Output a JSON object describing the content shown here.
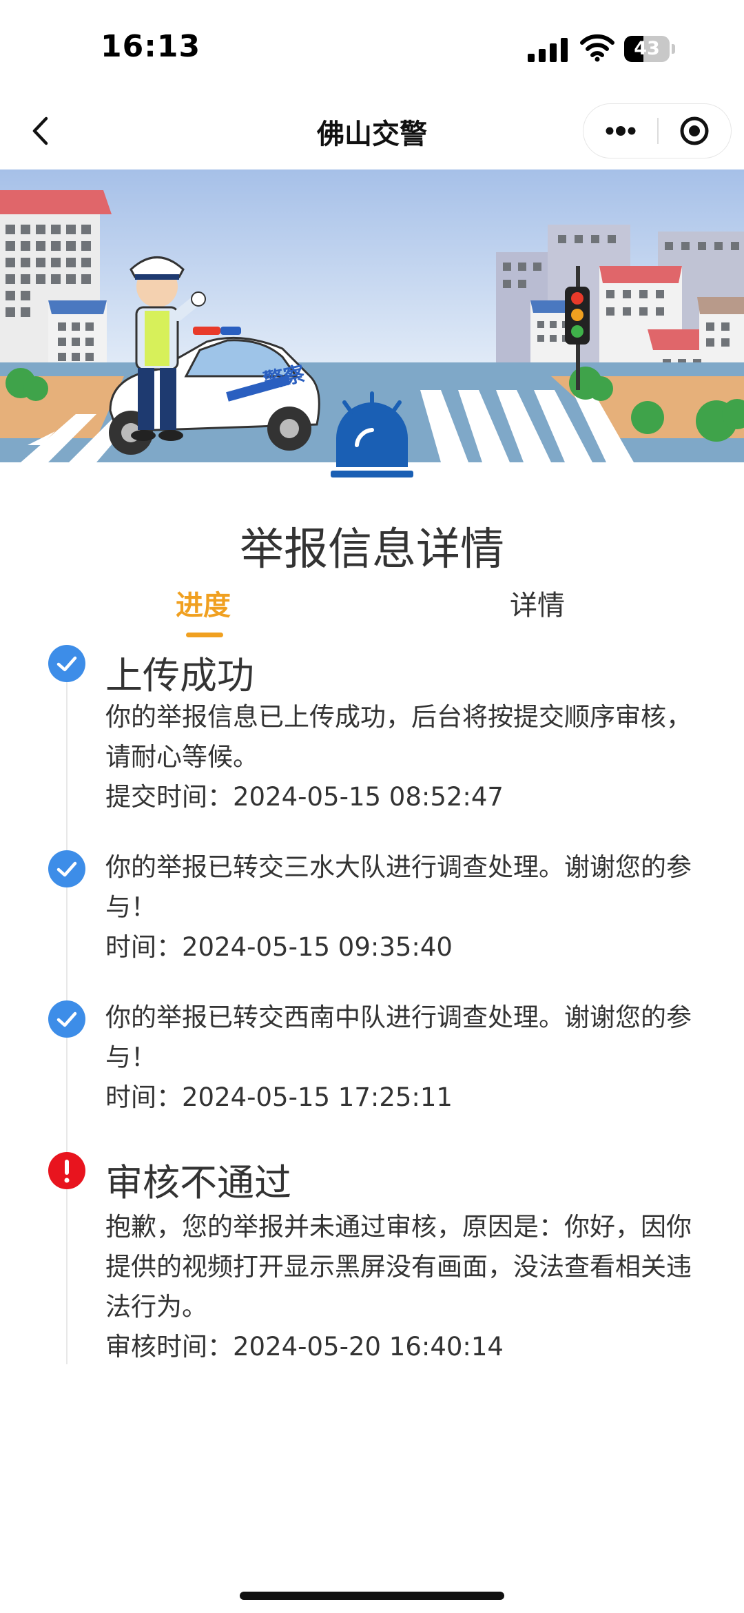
{
  "status_bar": {
    "time": "16:13",
    "battery": "43",
    "battery_fraction": 0.43
  },
  "nav": {
    "title": "佛山交警"
  },
  "page": {
    "title": "举报信息详情",
    "tabs": [
      {
        "label": "进度",
        "active": true
      },
      {
        "label": "详情",
        "active": false
      }
    ]
  },
  "timeline": [
    {
      "status": "success",
      "heading": "上传成功",
      "text": "你的举报信息已上传成功，后台将按提交顺序审核，请耐心等候。",
      "time": "提交时间：2024-05-15 08:52:47"
    },
    {
      "status": "success",
      "heading": "",
      "text": "你的举报已转交三水大队进行调查处理。谢谢您的参与！",
      "time": "时间：2024-05-15 09:35:40"
    },
    {
      "status": "success",
      "heading": "",
      "text": "你的举报已转交西南中队进行调查处理。谢谢您的参与！",
      "time": "时间：2024-05-15 17:25:11"
    },
    {
      "status": "error",
      "heading": "审核不通过",
      "text": "抱歉，您的举报并未通过审核，原因是：你好，因你提供的视频打开显示黑屏没有画面，没法查看相关违法行为。",
      "time": "审核时间：2024-05-20 16:40:14"
    }
  ],
  "banner": {
    "car_label": "警察",
    "icon": "police-siren-icon"
  },
  "colors": {
    "accent": "#f0a020",
    "success": "#3d8de8",
    "error": "#e8141e",
    "siren": "#1a5fb4"
  }
}
